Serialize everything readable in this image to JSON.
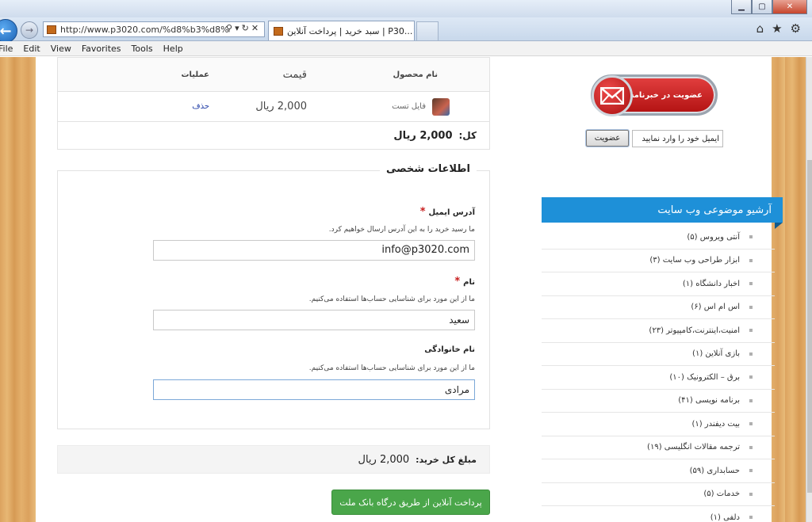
{
  "browser": {
    "url": "http://www.p3020.com/%d8%b3%d8%",
    "tab_title": "سبد خرید | پرداخت آنلاین | P30...",
    "tab_close": "✕",
    "menu": [
      "File",
      "Edit",
      "View",
      "Favorites",
      "Tools",
      "Help"
    ]
  },
  "cart": {
    "headers": {
      "product": "نام محصول",
      "price": "قیمت",
      "ops": "عملیات"
    },
    "item": {
      "name": "فایل تست",
      "price": "2,000 ریال",
      "delete": "حذف"
    },
    "total_label": "کل:",
    "total_value": "2,000 ریال"
  },
  "personal": {
    "legend": "اطلاعات شخصی",
    "email_label": "آدرس ایمیل",
    "email_desc": "ما رسید خرید را به این آدرس ارسال خواهیم کرد.",
    "email_value": "info@p3020.com",
    "name_label": "نام",
    "name_desc": "ما از این مورد برای شناسایی حساب‌ها استفاده می‌کنیم.",
    "name_value": "سعید",
    "family_label": "نام خانوادگی",
    "family_desc": "ما از این مورد برای شناسایی حساب‌ها استفاده می‌کنیم.",
    "family_value": "مرادی",
    "required_mark": "*"
  },
  "summary": {
    "grand_label": "مبلغ کل خرید:",
    "grand_value": "2,000 ریال",
    "pay_button": "پرداخت آنلاین از طریق درگاه بانک ملت"
  },
  "sidebar": {
    "newsletter_button": "عضویت در خبرنامه",
    "email_placeholder": "ایمیل خود را وارد نمایید",
    "subscribe_button": "عضویت",
    "archive_title": "آرشیو موضوعی وب سایت",
    "categories": [
      "آنتی ویروس (۵)",
      "ابزار طراحی وب سایت (۳)",
      "اخبار دانشگاه (۱)",
      "اس ام اس (۶)",
      "امنیت،اینترنت،کامپیوتر (۲۳)",
      "بازی آنلاین (۱)",
      "برق – الکترونیک (۱۰)",
      "برنامه نویسی (۴۱)",
      "بیت دیفندر (۱)",
      "ترجمه مقالات انگلیسی (۱۹)",
      "حسابداری (۵۹)",
      "خدمات (۵)",
      "دلفی (۱)"
    ]
  },
  "colors": {
    "accent_blue": "#1e90d8",
    "pay_green": "#4aa64a",
    "newsletter_red": "#c81e1e"
  }
}
